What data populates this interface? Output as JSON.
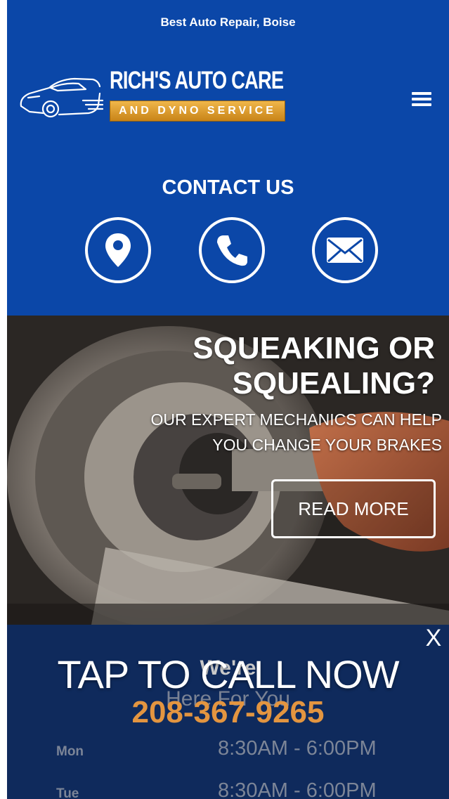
{
  "header": {
    "tagline": "Best Auto Repair, Boise",
    "logo_title": "RICH'S AUTO CARE",
    "logo_subtitle": "AND DYNO SERVICE",
    "menu_icon": "hamburger-menu-icon"
  },
  "contact": {
    "title": "CONTACT US",
    "icons": [
      "map-pin-icon",
      "phone-icon",
      "envelope-icon"
    ]
  },
  "hero": {
    "headline_line1": "SQUEAKING OR",
    "headline_line2": "SQUEALING?",
    "subtext_line1": "OUR EXPERT MECHANICS CAN HELP",
    "subtext_line2": "YOU CHANGE YOUR BRAKES",
    "button_label": "READ MORE"
  },
  "hours": {
    "title_line1": "We're",
    "title_line2": "Here For You",
    "rows": [
      {
        "day": "Mon",
        "time": "8:30AM - 6:00PM"
      },
      {
        "day": "Tue",
        "time": "8:30AM - 6:00PM"
      }
    ]
  },
  "call_overlay": {
    "close_label": "X",
    "heading": "TAP TO CALL NOW",
    "phone": "208-367-9265"
  },
  "colors": {
    "header_blue": "#0b47a8",
    "overlay_navy": "#0f2a5c",
    "phone_orange": "#e39540",
    "logo_gold": "#d99a2b"
  }
}
